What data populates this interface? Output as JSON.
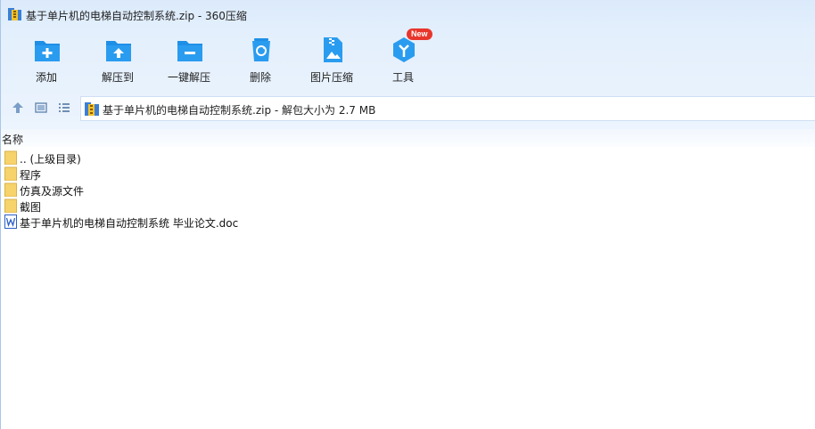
{
  "window": {
    "title": "基于单片机的电梯自动控制系统.zip - 360压缩"
  },
  "toolbar": {
    "items": [
      {
        "label": "添加",
        "icon": "add-folder-icon"
      },
      {
        "label": "解压到",
        "icon": "extract-to-icon"
      },
      {
        "label": "一键解压",
        "icon": "one-click-extract-icon"
      },
      {
        "label": "删除",
        "icon": "recycle-bin-icon"
      },
      {
        "label": "图片压缩",
        "icon": "image-compress-icon"
      },
      {
        "label": "工具",
        "icon": "tools-icon",
        "badge": "New"
      }
    ]
  },
  "nav": {
    "address": "基于单片机的电梯自动控制系统.zip - 解包大小为 2.7 MB"
  },
  "list": {
    "column_name": "名称",
    "rows": [
      {
        "name": ".. (上级目录)",
        "type": "folder"
      },
      {
        "name": "程序",
        "type": "folder"
      },
      {
        "name": "仿真及源文件",
        "type": "folder"
      },
      {
        "name": "截图",
        "type": "folder"
      },
      {
        "name": "基于单片机的电梯自动控制系统 毕业论文.doc",
        "type": "doc"
      }
    ]
  },
  "colors": {
    "accent": "#1e8fe6",
    "folder": "#f7d36b",
    "badge": "#e8362c",
    "word_blue": "#2b5fc7"
  }
}
